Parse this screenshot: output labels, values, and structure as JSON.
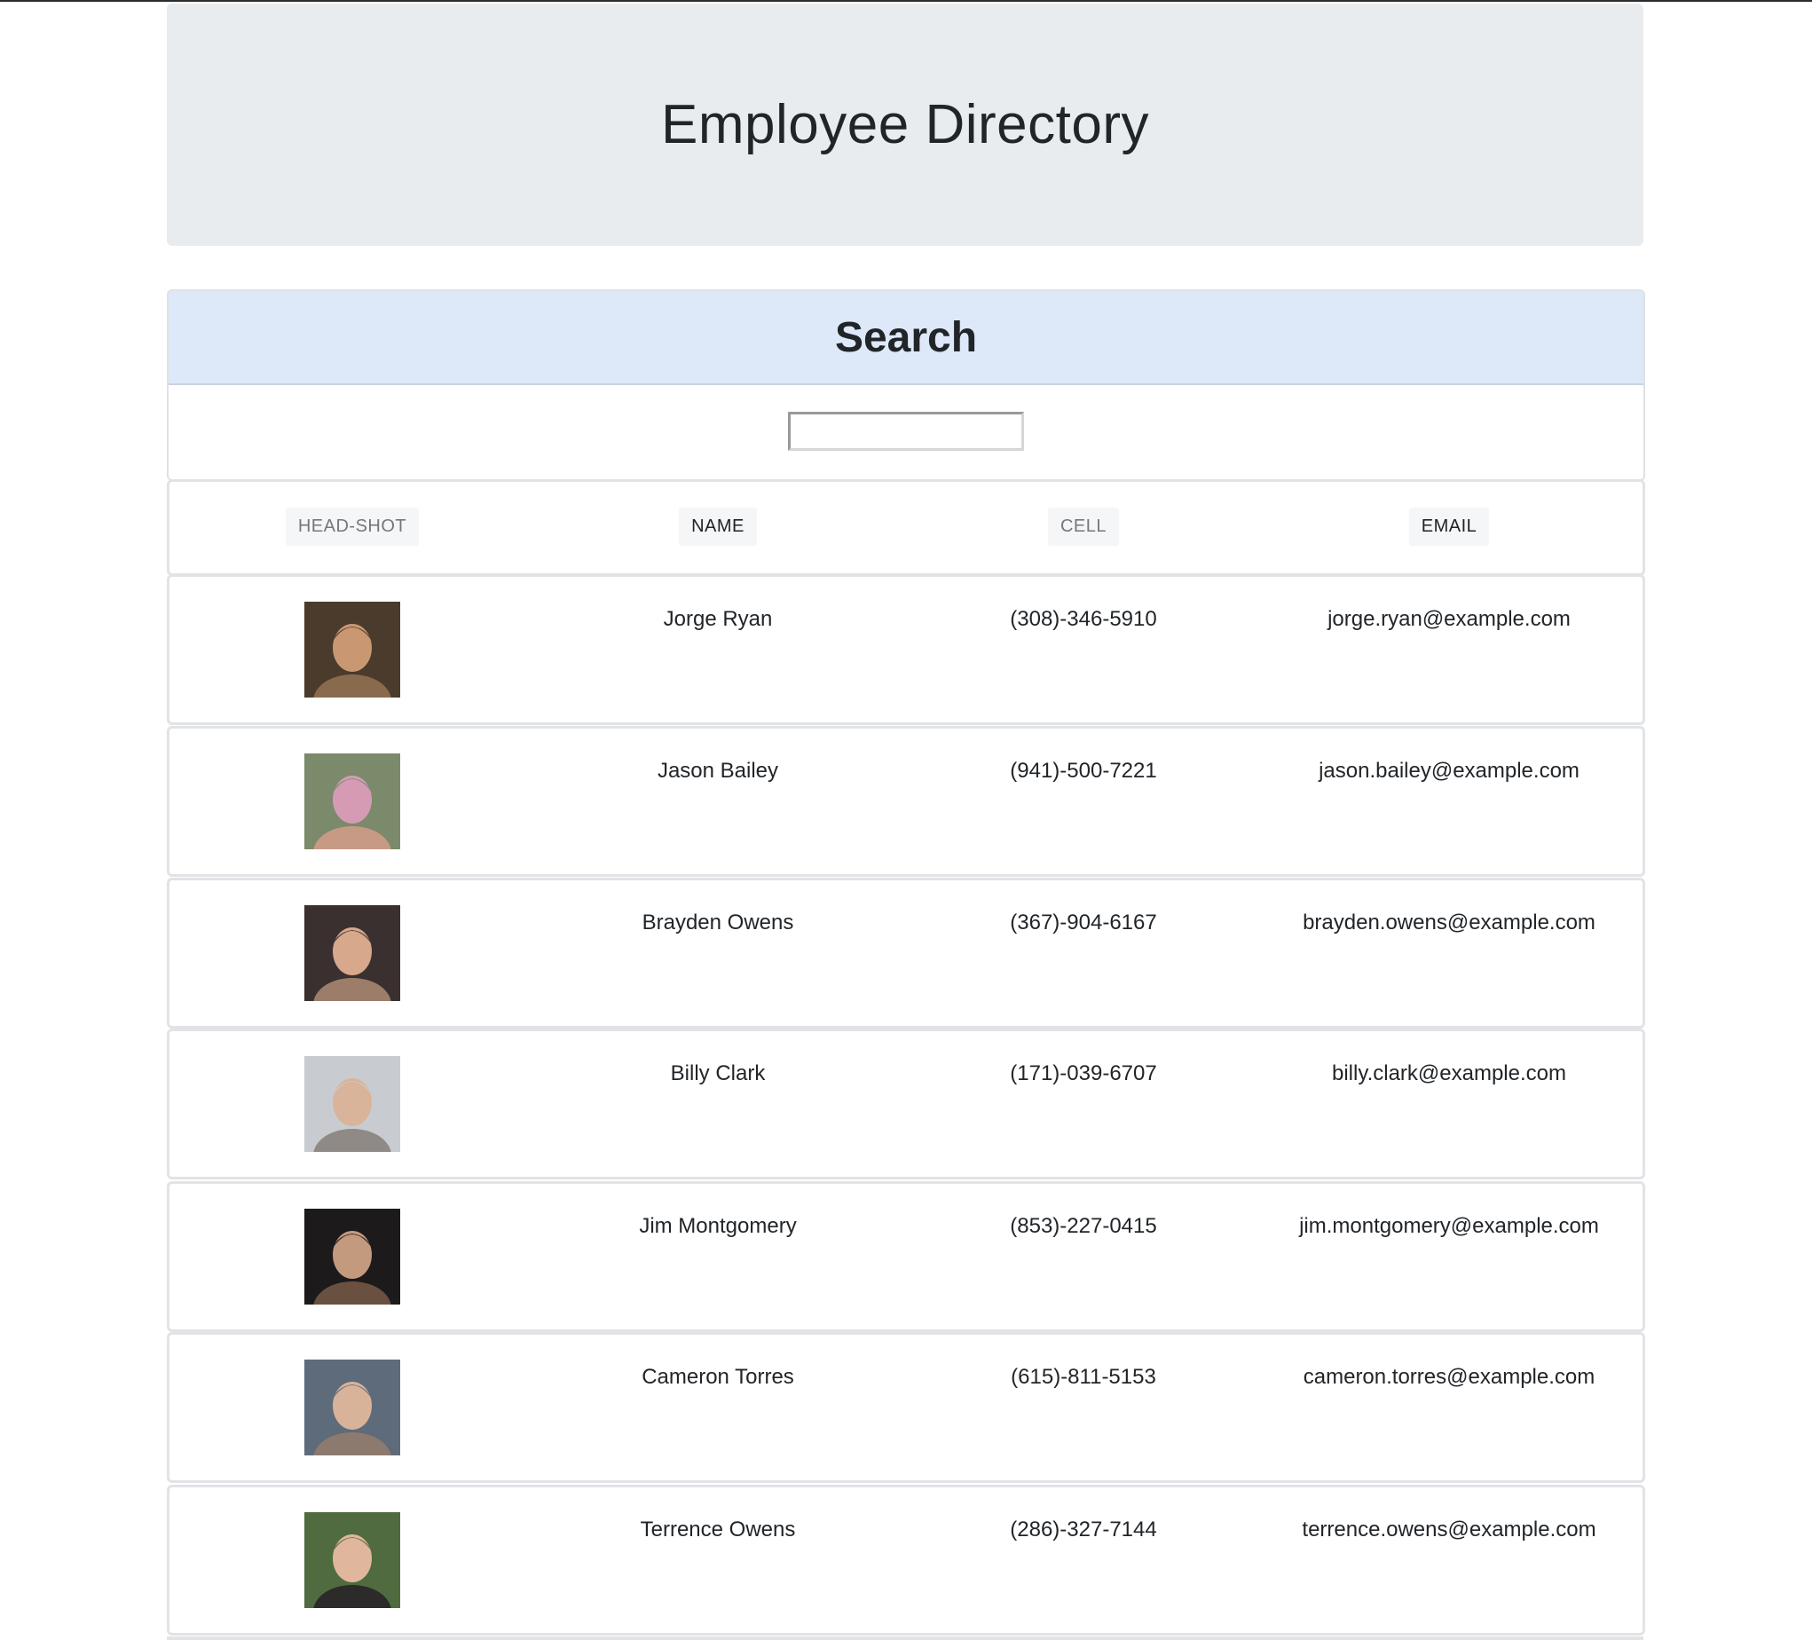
{
  "header": {
    "title": "Employee Directory"
  },
  "search": {
    "title": "Search",
    "value": "",
    "placeholder": ""
  },
  "table": {
    "columns": [
      "HEAD-SHOT",
      "NAME",
      "CELL",
      "EMAIL"
    ],
    "rows": [
      {
        "name": "Jorge Ryan",
        "cell": "(308)-346-5910",
        "email": "jorge.ryan@example.com",
        "photo": "headshot-photo"
      },
      {
        "name": "Jason Bailey",
        "cell": "(941)-500-7221",
        "email": "jason.bailey@example.com",
        "photo": "headshot-photo"
      },
      {
        "name": "Brayden Owens",
        "cell": "(367)-904-6167",
        "email": "brayden.owens@example.com",
        "photo": "headshot-photo"
      },
      {
        "name": "Billy Clark",
        "cell": "(171)-039-6707",
        "email": "billy.clark@example.com",
        "photo": "headshot-photo"
      },
      {
        "name": "Jim Montgomery",
        "cell": "(853)-227-0415",
        "email": "jim.montgomery@example.com",
        "photo": "headshot-photo"
      },
      {
        "name": "Cameron Torres",
        "cell": "(615)-811-5153",
        "email": "cameron.torres@example.com",
        "photo": "headshot-photo"
      },
      {
        "name": "Terrence Owens",
        "cell": "(286)-327-7144",
        "email": "terrence.owens@example.com",
        "photo": "headshot-photo"
      }
    ]
  },
  "colors": {
    "jumbotron_bg": "#e9ecef",
    "search_header_bg": "#dde8f8",
    "border": "#dee2e6",
    "text": "#212529",
    "muted_header": "#777777"
  }
}
